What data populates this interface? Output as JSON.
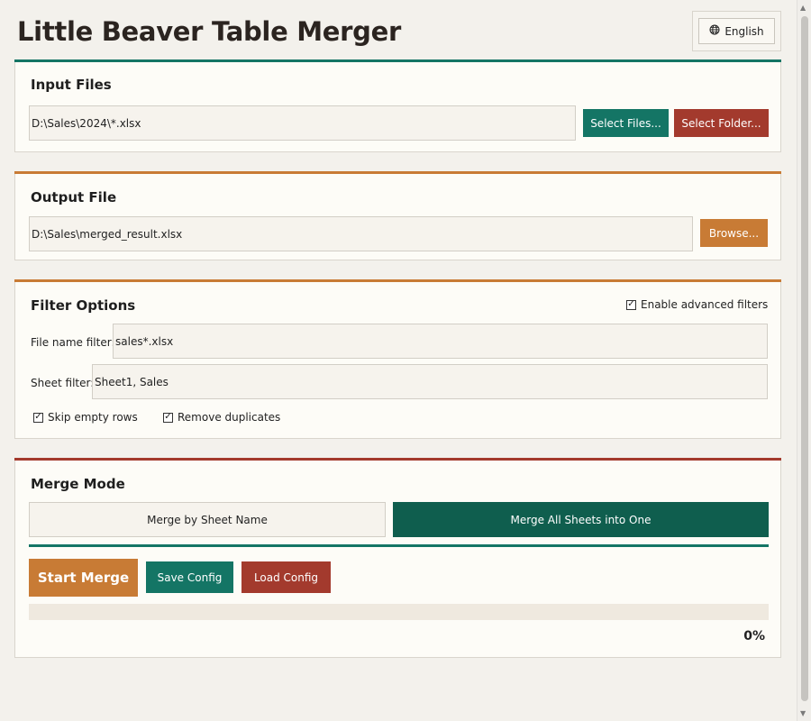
{
  "app": {
    "title": "Little Beaver Table Merger",
    "language_label": "English"
  },
  "colors": {
    "teal": "#147565",
    "dark_teal": "#0f5e4e",
    "red": "#a33a2d",
    "orange": "#c87b35",
    "background": "#f3f1ec",
    "panel": "#fdfcf7"
  },
  "input_files": {
    "title": "Input Files",
    "path_value": "D:\\Sales\\2024\\*.xlsx",
    "select_files_label": "Select Files...",
    "select_folder_label": "Select Folder..."
  },
  "output_file": {
    "title": "Output File",
    "path_value": "D:\\Sales\\merged_result.xlsx",
    "browse_label": "Browse..."
  },
  "filter_options": {
    "title": "Filter Options",
    "advanced_label": "Enable advanced filters",
    "advanced_checked": true,
    "file_name_filter_label": "File name filter:",
    "file_name_filter_value": "sales*.xlsx",
    "sheet_filter_label": "Sheet filter:",
    "sheet_filter_value": "Sheet1, Sales",
    "skip_empty_label": "Skip empty rows",
    "skip_empty_checked": true,
    "remove_duplicates_label": "Remove duplicates",
    "remove_duplicates_checked": true
  },
  "merge_mode": {
    "title": "Merge Mode",
    "options": [
      {
        "label": "Merge by Sheet Name",
        "selected": false
      },
      {
        "label": "Merge All Sheets into One",
        "selected": true
      }
    ]
  },
  "actions": {
    "start_label": "Start Merge",
    "save_label": "Save Config",
    "load_label": "Load Config"
  },
  "progress": {
    "value": 0,
    "text": "0%"
  },
  "icons": {
    "language": "globe-icon",
    "checkbox": "check-icon"
  }
}
